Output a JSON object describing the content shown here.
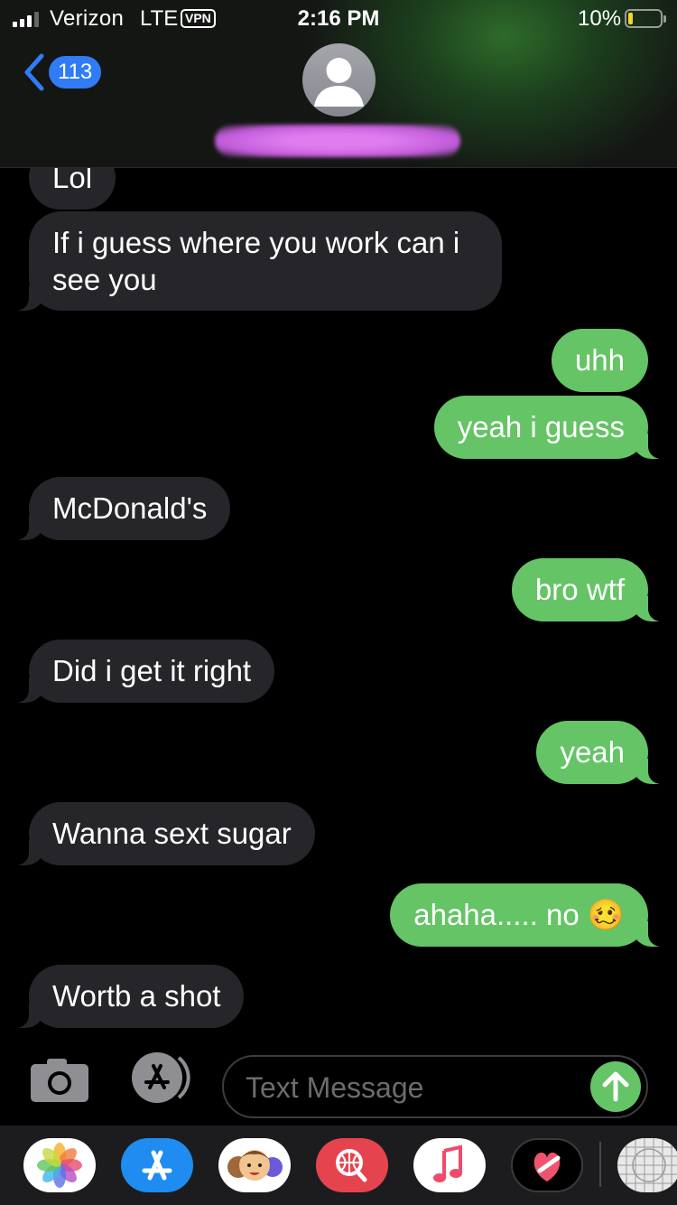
{
  "status_bar": {
    "carrier": "Verizon",
    "network": "LTE",
    "vpn": "VPN",
    "time": "2:16 PM",
    "battery": "10%",
    "battery_level": 0.1,
    "battery_color": "#f7d230"
  },
  "nav": {
    "unread_count": "113",
    "back_icon": "chevron-left-icon",
    "avatar_icon": "person-silhouette-icon",
    "contact_name_redacted": true
  },
  "messages": [
    {
      "from": "them",
      "text": "Lol"
    },
    {
      "from": "them",
      "text": "If i guess where you work can i see you"
    },
    {
      "from": "me",
      "text": "uhh"
    },
    {
      "from": "me",
      "text": "yeah i guess"
    },
    {
      "from": "them",
      "text": "McDonald's"
    },
    {
      "from": "me",
      "text": "bro wtf"
    },
    {
      "from": "them",
      "text": "Did i get it right"
    },
    {
      "from": "me",
      "text": "yeah"
    },
    {
      "from": "them",
      "text": "Wanna sext sugar"
    },
    {
      "from": "me",
      "text": "ahaha..... no 🥴"
    },
    {
      "from": "them",
      "text": "Wortb a shot"
    }
  ],
  "input": {
    "placeholder": "Text Message",
    "camera_icon": "camera-icon",
    "apps_icon": "app-store-icon",
    "send_icon": "arrow-up-icon"
  },
  "app_drawer": [
    {
      "name": "photos-app-icon"
    },
    {
      "name": "app-store-app-icon"
    },
    {
      "name": "memoji-app-icon"
    },
    {
      "name": "web-search-app-icon"
    },
    {
      "name": "music-app-icon"
    },
    {
      "name": "digital-touch-app-icon"
    },
    {
      "name": "grid-app-icon"
    }
  ],
  "colors": {
    "sent_bubble": "#65c466",
    "received_bubble": "#26252a",
    "accent_blue": "#2f7cf6",
    "background": "#000000"
  }
}
